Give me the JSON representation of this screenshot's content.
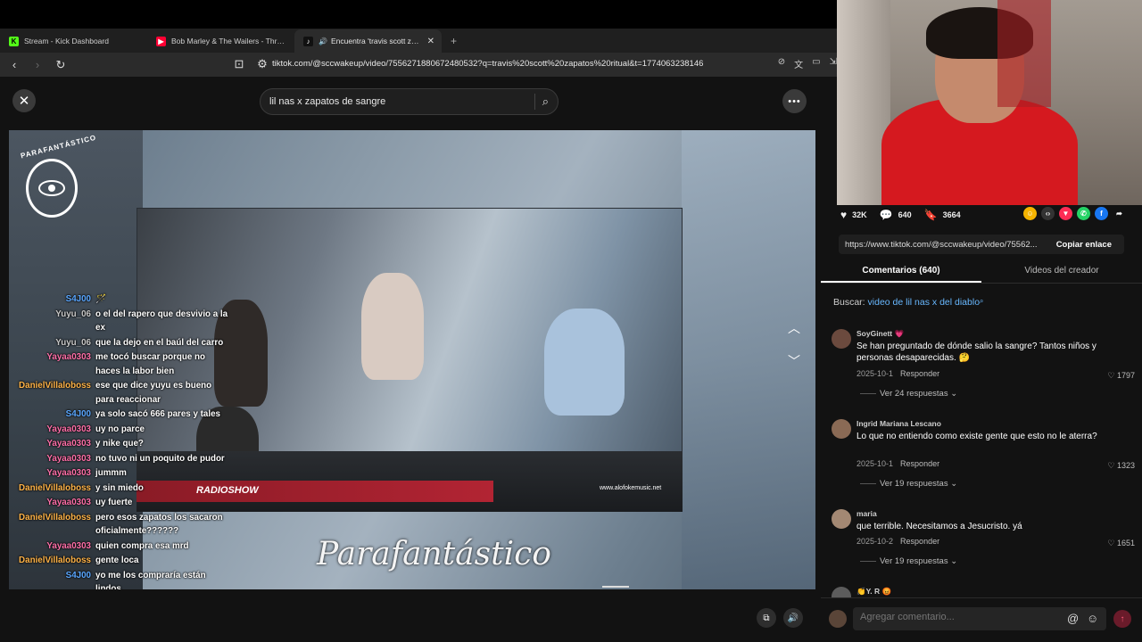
{
  "browser": {
    "tabs": [
      {
        "label": "Stream - Kick Dashboard",
        "fav": "K",
        "favcolor": "#53fc18",
        "active": false
      },
      {
        "label": "Bob Marley & The Wailers - Three Li",
        "fav": "▶",
        "favcolor": "#ff0033",
        "active": false
      },
      {
        "label": "Encuentra 'travis scott zapato",
        "fav": "♪",
        "favcolor": "#111111",
        "active": true
      }
    ],
    "url": "tiktok.com/@sccwakeup/video/7556271880672480532?q=travis%20scott%20zapatos%20ritual&t=1774063238146"
  },
  "search": {
    "value": "lil nas x zapatos de sangre"
  },
  "video": {
    "logo_text": "PARAFANTÁSTICO",
    "watermark": "Parafantástico",
    "radio_label": "RADIOSHOW",
    "site_label": "www.alofokemusic.net"
  },
  "chat": [
    {
      "user": "S4J00",
      "text": "🪄",
      "color": "#5aa7ff"
    },
    {
      "user": "Yuyu_06",
      "text": "o el del rapero que desvivio a la ex",
      "color": "#c9c9c9"
    },
    {
      "user": "Yuyu_06",
      "text": "que la dejo en el baúl del carro",
      "color": "#c9c9c9"
    },
    {
      "user": "Yayaa0303",
      "text": "me tocó buscar porque no haces la labor bien",
      "color": "#ff6fa8"
    },
    {
      "user": "DanielVillaloboss",
      "text": "ese que dice yuyu es bueno para reaccionar",
      "color": "#ffb347"
    },
    {
      "user": "S4J00",
      "text": "ya solo sacó 666 pares y tales",
      "color": "#5aa7ff"
    },
    {
      "user": "Yayaa0303",
      "text": "uy no parce",
      "color": "#ff6fa8"
    },
    {
      "user": "Yayaa0303",
      "text": "y nike que?",
      "color": "#ff6fa8"
    },
    {
      "user": "Yayaa0303",
      "text": "no tuvo ni un poquito de pudor",
      "color": "#ff6fa8"
    },
    {
      "user": "Yayaa0303",
      "text": "jummm",
      "color": "#ff6fa8"
    },
    {
      "user": "DanielVillaloboss",
      "text": "y sin miedo",
      "color": "#ffb347"
    },
    {
      "user": "Yayaa0303",
      "text": "uy fuerte",
      "color": "#ff6fa8"
    },
    {
      "user": "DanielVillaloboss",
      "text": "pero esos zapatos los sacaron oficialmente??????",
      "color": "#ffb347"
    },
    {
      "user": "Yayaa0303",
      "text": "quien compra esa mrd",
      "color": "#ff6fa8"
    },
    {
      "user": "DanielVillaloboss",
      "text": "gente loca",
      "color": "#ffb347"
    },
    {
      "user": "S4J00",
      "text": "yo me los compraría están lindos",
      "color": "#5aa7ff"
    },
    {
      "user": "S4J00",
      "text": "🐧",
      "color": "#5aa7ff"
    }
  ],
  "stats": {
    "likes": "32K",
    "comments": "640",
    "saves": "3664"
  },
  "link": {
    "url": "https://www.tiktok.com/@sccwakeup/video/75562...",
    "copy": "Copiar enlace"
  },
  "panel_tabs": {
    "comments": "Comentarios (640)",
    "creator": "Videos del creador"
  },
  "search_suggest": {
    "prefix": "Buscar:",
    "query": "video de lil nas x del diablo"
  },
  "comments": [
    {
      "name": "SoyGinett 💗",
      "text": "Se han preguntado de dónde salio la sangre? Tantos niños y personas desaparecidas. 🤔",
      "date": "2025-10-1",
      "reply": "Responder",
      "likes": "1797",
      "replies": "Ver 24 respuestas",
      "avatar": "#6b4a3e"
    },
    {
      "name": "Ingrid Mariana Lescano",
      "text": "Lo que no entiendo como existe gente que esto no le aterra?",
      "date": "2025-10-1",
      "reply": "Responder",
      "likes": "1323",
      "replies": "Ver 19 respuestas",
      "avatar": "#8a6a55"
    },
    {
      "name": "maria",
      "text": "que terrible. Necesitamos a Jesucristo. yá",
      "date": "2025-10-2",
      "reply": "Responder",
      "likes": "1651",
      "replies": "Ver 19 respuestas",
      "avatar": "#a38873"
    },
    {
      "name": "👏Y. R 😡",
      "text": "",
      "date": "",
      "reply": "",
      "likes": "",
      "replies": "",
      "avatar": "#5c5c5c"
    }
  ],
  "add_comment": {
    "placeholder": "Agregar comentario..."
  }
}
